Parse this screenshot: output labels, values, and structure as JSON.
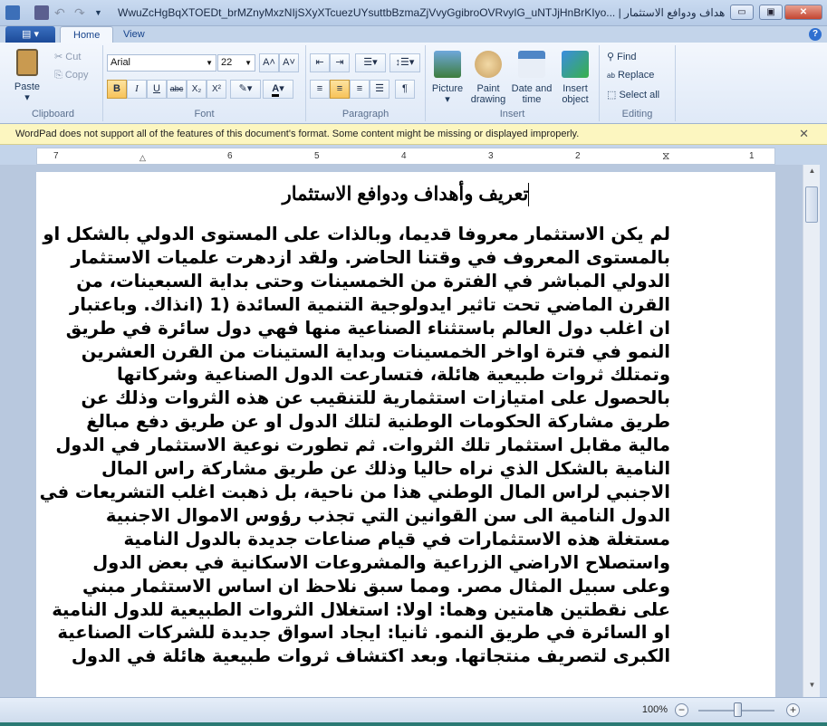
{
  "window": {
    "title": "WwuZcHgBqXTOEDt_brMZnyMxzNIjSXyXTcuezUYsuttbBzmaZjVvyGgibroOVRvyIG_uNTJjHnBrKIyo... | تعريف وأهداف ودوافع الاستثمار",
    "minimize": "▭",
    "maximize": "▣",
    "close": "✕"
  },
  "tabs": [
    {
      "label": "Home"
    },
    {
      "label": "View"
    }
  ],
  "help": "?",
  "ribbon": {
    "clipboard": {
      "label": "Clipboard",
      "paste": "Paste",
      "cut": "Cut",
      "copy": "Copy"
    },
    "font": {
      "label": "Font",
      "family": "Arial",
      "size": "22",
      "bold": "B",
      "italic": "I",
      "underline": "U",
      "strike": "abc",
      "subscript": "X₂",
      "superscript": "X²",
      "grow": "A˄",
      "shrink": "A˅"
    },
    "paragraph": {
      "label": "Paragraph"
    },
    "insert": {
      "label": "Insert",
      "picture": "Picture",
      "paint": "Paint drawing",
      "datetime": "Date and time",
      "object": "Insert object"
    },
    "editing": {
      "label": "Editing",
      "find": "Find",
      "replace": "Replace",
      "select_all": "Select all"
    }
  },
  "infobar": {
    "message": "WordPad does not support all of the features of this document's format. Some content might be missing or displayed improperly.",
    "close": "✕"
  },
  "ruler": {
    "ticks": [
      "7",
      "6",
      "5",
      "4",
      "3",
      "2",
      "1",
      "1"
    ]
  },
  "document": {
    "title": "تعريف وأهداف ودوافع الاستثمار",
    "lines": [
      "لم يكن الاستثمار معروفا قديما، وبالذات على المستوى الدولي بالشكل او",
      "بالمستوى المعروف في وقتنا الحاضر. ولقد ازدهرت علميات الاستثمار",
      "الدولي المباشر في الفترة من الخمسينات وحتى بداية السبعينات، من",
      "القرن الماضي تحت تاثير ايدولوجية التنمية السائدة (1 (انذاك. وباعتبار",
      "ان اغلب دول العالم باستثناء الصناعية منها فهي دول سائرة في طريق",
      "النمو في فترة اواخر الخمسينات وبداية الستينات من القرن العشرين",
      "وتمتلك ثروات طبيعية هائلة، فتسارعت الدول الصناعية وشركاتها",
      "بالحصول على امتيازات استثمارية للتنقيب عن هذه الثروات وذلك عن",
      "طريق مشاركة الحكومات الوطنية لتلك الدول او عن طريق دفع مبالغ",
      "مالية مقابل استثمار تلك الثروات. ثم تطورت نوعية الاستثمار في الدول",
      "النامية بالشكل الذي نراه حاليا وذلك عن طريق مشاركة راس المال",
      "الاجنبي لراس المال الوطني هذا من ناحية، بل ذهبت اغلب التشريعات في",
      "الدول النامية الى سن القوانين التي تجذب رؤوس الاموال الاجنبية",
      "مستغلة هذه الاستثمارات في قيام صناعات جديدة بالدول النامية",
      "واستصلاح الاراضي الزراعية والمشروعات الاسكانية في بعض الدول",
      "وعلى سبيل المثال مصر. ومما سبق نلاحظ ان اساس الاستثمار مبني",
      "على نقطتين هامتين وهما: اولا: استغلال الثروات الطبيعية للدول النامية",
      "او السائرة في طريق النمو. ثانيا: ايجاد اسواق جديدة للشركات الصناعية",
      "الكبرى لتصريف منتجاتها. وبعد اكتشاف ثروات طبيعية هائلة في الدول"
    ]
  },
  "status": {
    "zoom": "100%",
    "zoom_percent": 100,
    "zoom_out": "−",
    "zoom_in": "+"
  }
}
